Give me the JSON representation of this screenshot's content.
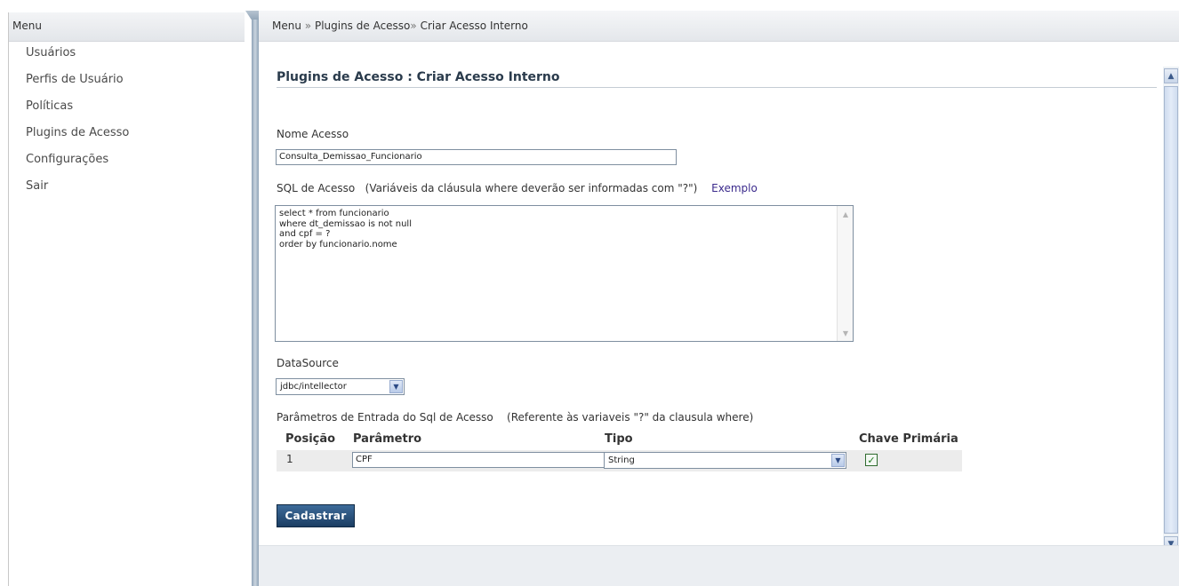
{
  "sidebar": {
    "header": "Menu",
    "items": [
      {
        "label": "Usuários"
      },
      {
        "label": "Perfis de Usuário"
      },
      {
        "label": "Políticas"
      },
      {
        "label": "Plugins de Acesso"
      },
      {
        "label": "Configurações"
      },
      {
        "label": "Sair"
      }
    ]
  },
  "breadcrumb": {
    "part1": "Menu",
    "sep1": "»",
    "part2": "Plugins de Acesso",
    "sep2": "»",
    "part3": "Criar Acesso Interno"
  },
  "page": {
    "title": "Plugins de Acesso : Criar Acesso Interno"
  },
  "form": {
    "nome_label": "Nome Acesso",
    "nome_value": "Consulta_Demissao_Funcionario",
    "sql_label": "SQL de Acesso",
    "sql_hint": "(Variáveis da cláusula where deverão ser informadas com \"?\")",
    "sql_example_link": "Exemplo",
    "sql_value": "select * from funcionario\nwhere dt_demissao is not null\nand cpf = ?\norder by funcionario.nome",
    "datasource_label": "DataSource",
    "datasource_value": "jdbc/intellector",
    "params_label": "Parâmetros de Entrada do Sql de Acesso",
    "params_hint": "(Referente às variaveis \"?\" da clausula where)",
    "submit_label": "Cadastrar"
  },
  "params_table": {
    "headers": {
      "posicao": "Posição",
      "parametro": "Parâmetro",
      "tipo": "Tipo",
      "chave": "Chave Primária"
    },
    "rows": [
      {
        "posicao": "1",
        "parametro": "CPF",
        "tipo": "String",
        "chave_checked": true
      }
    ]
  },
  "icons": {
    "check": "✓",
    "dropdown": "chevron-down-icon",
    "scroll_up": "chevron-up-icon",
    "scroll_down": "chevron-down-icon"
  }
}
